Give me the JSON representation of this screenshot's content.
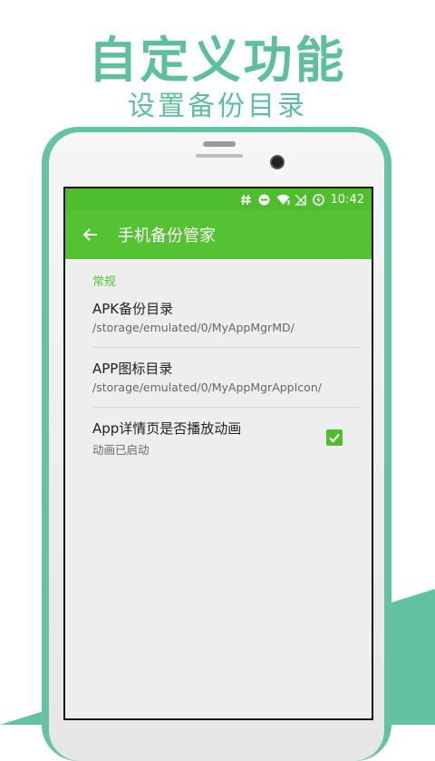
{
  "promo": {
    "headline": "自定义功能",
    "subline": "设置备份目录"
  },
  "status_bar": {
    "time": "10:42",
    "icons": [
      "hash-icon",
      "dnd-icon",
      "wifi-icon",
      "no-sim-icon",
      "battery-charging-icon"
    ]
  },
  "app_bar": {
    "title": "手机备份管家",
    "back_icon": "arrow-left-icon"
  },
  "settings": {
    "section_label": "常规",
    "items": [
      {
        "title": "APK备份目录",
        "summary": "/storage/emulated/0/MyAppMgrMD/"
      },
      {
        "title": "APP图标目录",
        "summary": "/storage/emulated/0/MyAppMgrAppIcon/"
      },
      {
        "title": "App详情页是否播放动画",
        "summary": "动画已启动",
        "checked": true
      }
    ]
  },
  "colors": {
    "accent": "#55c234",
    "promo": "#5cc09c",
    "phone_frame": "#66c2a5"
  }
}
